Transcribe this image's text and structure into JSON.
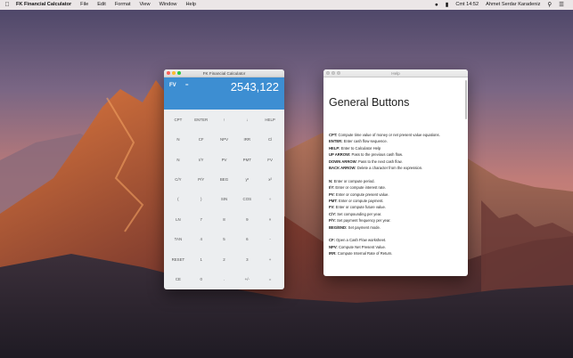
{
  "menubar": {
    "app_name": "FK Financial Calculator",
    "menus": [
      "File",
      "Edit",
      "Format",
      "View",
      "Window",
      "Help"
    ],
    "clock": "Cmt 14:52",
    "user": "Ahmet Serdar Karadeniz"
  },
  "calculator": {
    "title": "FK Financial Calculator",
    "display": {
      "mode": "FV",
      "equals": "=",
      "value": "2543,122"
    },
    "keys": [
      "CPT",
      "ENTER",
      "↑",
      "↓",
      "HELP",
      "N",
      "CF",
      "NPV",
      "IRR",
      "Cl",
      "N",
      "I/Y",
      "PV",
      "PMT",
      "FV",
      "C/Y",
      "P/Y",
      "BEG",
      "yˣ",
      "x²",
      "(",
      ")",
      "SIN",
      "COS",
      "÷",
      "LN",
      "7",
      "8",
      "9",
      "×",
      "TAN",
      "4",
      "5",
      "6",
      "-",
      "RESET",
      "1",
      "2",
      "3",
      "+",
      "CE",
      "0",
      ".",
      "+/-",
      "="
    ]
  },
  "help": {
    "title": "Help",
    "heading": "General Buttons",
    "groups": [
      [
        {
          "key": "CPT:",
          "desc": " Compute time value of money or net present value equations."
        },
        {
          "key": "ENTER:",
          "desc": " Enter cash flow sequence."
        },
        {
          "key": "HELP:",
          "desc": " Enter to Calculator Help"
        },
        {
          "key": "UP ARROW:",
          "desc": " Pass to the previous cash flow."
        },
        {
          "key": "DOWN ARROW:",
          "desc": " Pass to the next cash flow."
        },
        {
          "key": "BACK ARROW:",
          "desc": " Delete a character from the expression."
        }
      ],
      [
        {
          "key": "N:",
          "desc": " Enter or compute period."
        },
        {
          "key": "I/Y:",
          "desc": " Enter or compute interest rate."
        },
        {
          "key": "PV:",
          "desc": " Enter or compute present value."
        },
        {
          "key": "PMT:",
          "desc": " Enter or compute payment."
        },
        {
          "key": "FV:",
          "desc": " Enter or compute future value."
        },
        {
          "key": "C/Y:",
          "desc": " Set compounding per year."
        },
        {
          "key": "P/Y:",
          "desc": " Set payment frequency per year."
        },
        {
          "key": "BEG/END:",
          "desc": " Set payment mode."
        }
      ],
      [
        {
          "key": "CF:",
          "desc": " Open a Cash Flow worksheet."
        },
        {
          "key": "NPV:",
          "desc": " Compute Net Present Value."
        },
        {
          "key": "IRR:",
          "desc": " Compute Internal Rate of Return."
        }
      ]
    ]
  },
  "colors": {
    "display_blue": "#3d8ed2",
    "keypad_bg": "#eceef0"
  }
}
